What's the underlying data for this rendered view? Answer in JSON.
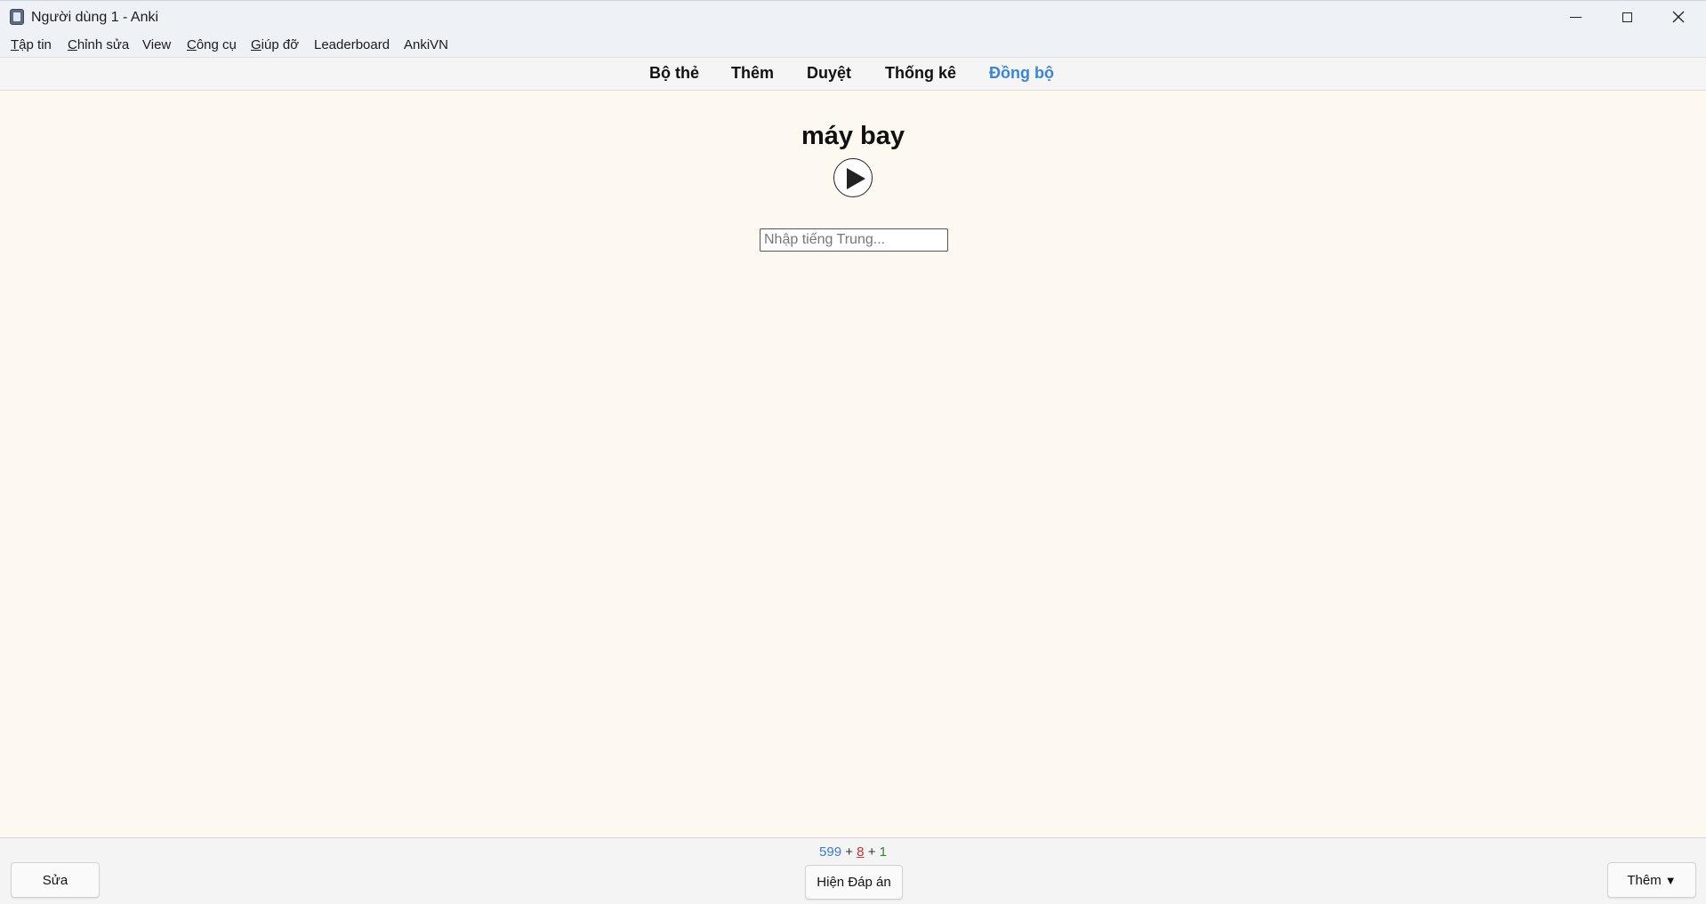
{
  "window": {
    "title": "Người dùng 1 - Anki",
    "icon": "anki-app-icon"
  },
  "menu": [
    {
      "label": "Tập tin"
    },
    {
      "label": "Chỉnh sửa"
    },
    {
      "label": "View"
    },
    {
      "label": "Công cụ"
    },
    {
      "label": "Giúp đỡ"
    },
    {
      "label": "Leaderboard"
    },
    {
      "label": "AnkiVN"
    }
  ],
  "toolbar": {
    "decks": "Bộ thẻ",
    "add": "Thêm",
    "browse": "Duyệt",
    "stats": "Thống kê",
    "sync": "Đồng bộ",
    "sync_color": "#3a86d6"
  },
  "card": {
    "word": "máy bay",
    "play_icon": "play-audio-icon",
    "input_placeholder": "Nhập tiếng Trung...",
    "input_value": ""
  },
  "bottom": {
    "counts": {
      "new": "599",
      "learning": "8",
      "review": "1",
      "separator": "+",
      "new_color": "#3a7ad6",
      "learning_color": "#c03535",
      "review_color": "#2c8a2c"
    },
    "edit_label": "Sửa",
    "show_answer_label": "Hiện Đáp án",
    "more_label": "Thêm",
    "more_caret": "▼"
  }
}
